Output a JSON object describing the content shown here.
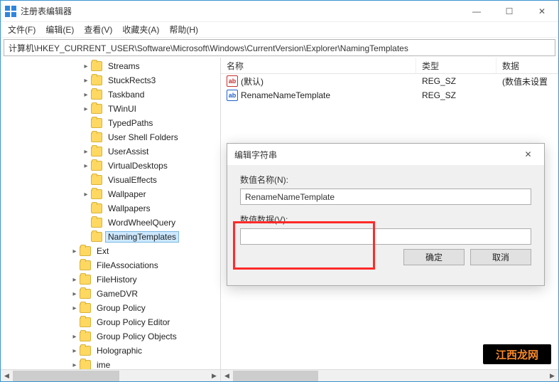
{
  "window": {
    "title": "注册表编辑器",
    "min": "—",
    "max": "☐",
    "close": "✕"
  },
  "menu": {
    "file": "文件(F)",
    "edit": "编辑(E)",
    "view": "查看(V)",
    "fav": "收藏夹(A)",
    "help": "帮助(H)"
  },
  "address": "计算机\\HKEY_CURRENT_USER\\Software\\Microsoft\\Windows\\CurrentVersion\\Explorer\\NamingTemplates",
  "tree": [
    {
      "indent": 113,
      "chev": "closed",
      "label": "Streams"
    },
    {
      "indent": 113,
      "chev": "closed",
      "label": "StuckRects3"
    },
    {
      "indent": 113,
      "chev": "closed",
      "label": "Taskband"
    },
    {
      "indent": 113,
      "chev": "closed",
      "label": "TWinUI"
    },
    {
      "indent": 113,
      "chev": "none",
      "label": "TypedPaths"
    },
    {
      "indent": 113,
      "chev": "none",
      "label": "User Shell Folders"
    },
    {
      "indent": 113,
      "chev": "closed",
      "label": "UserAssist"
    },
    {
      "indent": 113,
      "chev": "closed",
      "label": "VirtualDesktops"
    },
    {
      "indent": 113,
      "chev": "none",
      "label": "VisualEffects"
    },
    {
      "indent": 113,
      "chev": "closed",
      "label": "Wallpaper"
    },
    {
      "indent": 113,
      "chev": "none",
      "label": "Wallpapers"
    },
    {
      "indent": 113,
      "chev": "none",
      "label": "WordWheelQuery"
    },
    {
      "indent": 113,
      "chev": "none",
      "label": "NamingTemplates",
      "selected": true
    },
    {
      "indent": 97,
      "chev": "closed",
      "label": "Ext"
    },
    {
      "indent": 97,
      "chev": "none",
      "label": "FileAssociations"
    },
    {
      "indent": 97,
      "chev": "closed",
      "label": "FileHistory"
    },
    {
      "indent": 97,
      "chev": "closed",
      "label": "GameDVR"
    },
    {
      "indent": 97,
      "chev": "closed",
      "label": "Group Policy"
    },
    {
      "indent": 97,
      "chev": "none",
      "label": "Group Policy Editor"
    },
    {
      "indent": 97,
      "chev": "closed",
      "label": "Group Policy Objects"
    },
    {
      "indent": 97,
      "chev": "closed",
      "label": "Holographic"
    },
    {
      "indent": 97,
      "chev": "closed",
      "label": "ime"
    }
  ],
  "list": {
    "head": {
      "name": "名称",
      "type": "类型",
      "data": "数据"
    },
    "rows": [
      {
        "icon": "red",
        "name": "(默认)",
        "type": "REG_SZ",
        "data": "(数值未设置"
      },
      {
        "icon": "blue",
        "name": "RenameNameTemplate",
        "type": "REG_SZ",
        "data": ""
      }
    ]
  },
  "dialog": {
    "title": "编辑字符串",
    "close": "✕",
    "name_label": "数值名称(N):",
    "name_value": "RenameNameTemplate",
    "data_label": "数值数据(V):",
    "data_value": "",
    "ok": "确定",
    "cancel": "取消"
  },
  "watermark": "江西龙网",
  "icons": {
    "ab": "ab"
  }
}
